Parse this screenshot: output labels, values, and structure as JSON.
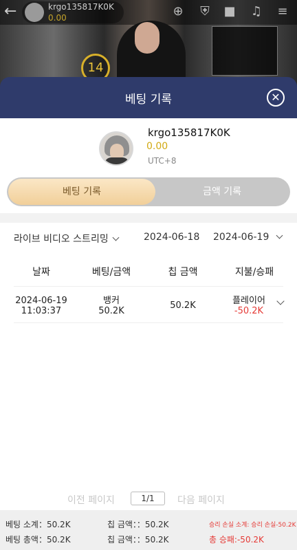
{
  "video": {
    "username": "krgo135817K0K",
    "balance": "0.00",
    "countdown": "14"
  },
  "modal": {
    "title": "베팅 기록"
  },
  "profile": {
    "username": "krgo135817K0K",
    "balance": "0.00",
    "timezone": "UTC+8"
  },
  "tabs": {
    "active": "베팅 기록",
    "inactive": "금액 기록"
  },
  "filters": {
    "game": "라이브 비디오 스트리밍",
    "start_date": "2024-06-18",
    "end_date": "2024-06-19"
  },
  "table": {
    "headers": [
      "날짜",
      "베팅/금액",
      "칩 금액",
      "지불/승패"
    ],
    "rows": [
      {
        "date": "2024-06-19",
        "time": "11:03:37",
        "bet_type": "뱅커",
        "bet_amount": "50.2K",
        "chip_amount": "50.2K",
        "payout_side": "플레이어",
        "payout_amount": "-50.2K"
      }
    ]
  },
  "pagination": {
    "prev": "이전 페이지",
    "current": "1/1",
    "next": "다음 페이지"
  },
  "summary": {
    "bet_subtotal": "베팅 소계：50.2K",
    "chip_subtotal": "칩 금액：：50.2K",
    "winloss_subtotal": "승리 손실 소계: 승리 손실-50.2K",
    "bet_total": "베팅 총액：50.2K",
    "chip_total": "칩 금액：：50.2K",
    "winloss_total": "총 승패:-50.2K"
  },
  "colors": {
    "header_bg": "#2f3b6b",
    "accent_gold": "#d1a912",
    "negative_red": "#e53935",
    "active_tab_bg": "#f1cf99"
  }
}
